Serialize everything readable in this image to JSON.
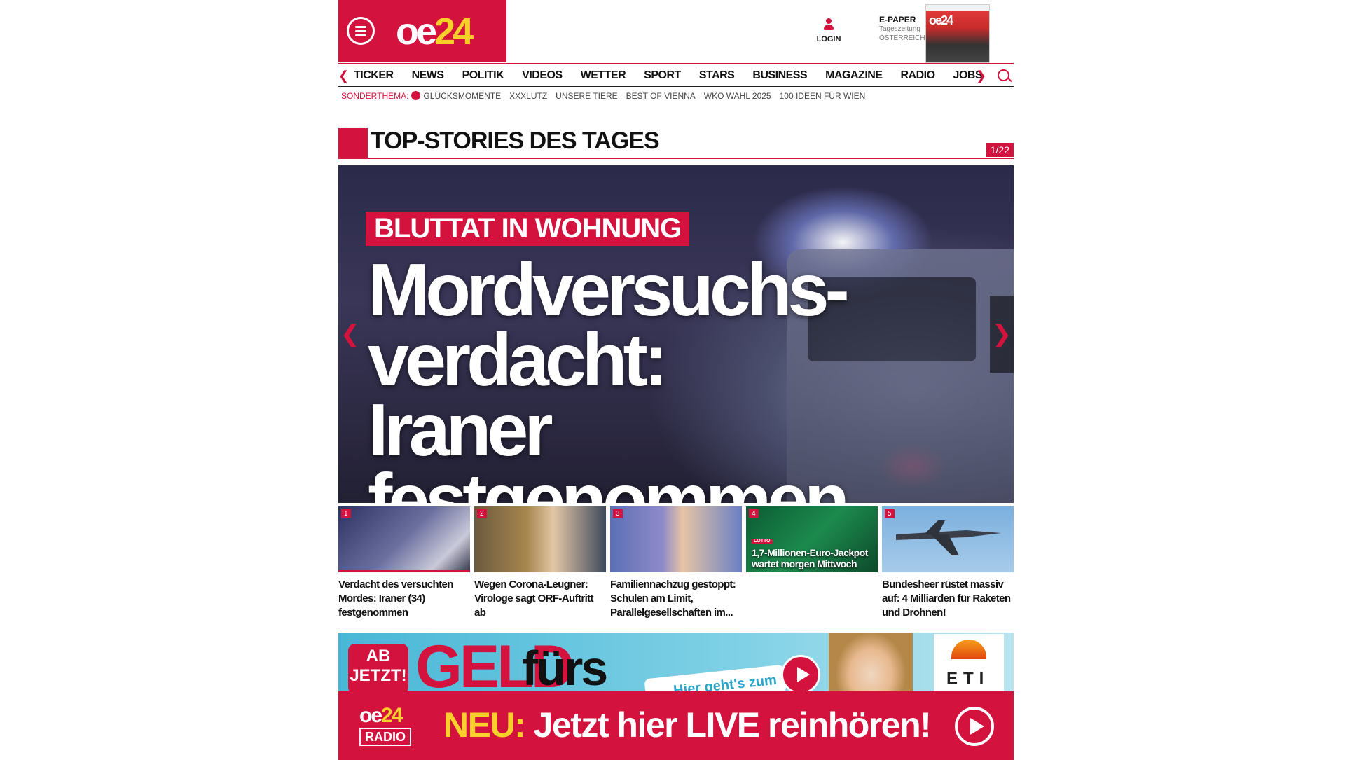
{
  "header": {
    "logo_main": "oe",
    "logo_accent": "24",
    "login_label": "LOGIN",
    "epaper_title": "E-PAPER",
    "epaper_sub1": "Tageszeitung",
    "epaper_sub2": "ÖSTERREICH",
    "cover_text": "oe24"
  },
  "nav": {
    "items": [
      "TICKER",
      "NEWS",
      "POLITIK",
      "VIDEOS",
      "WETTER",
      "SPORT",
      "STARS",
      "BUSINESS",
      "MAGAZINE",
      "RADIO",
      "JOBS"
    ],
    "prev_arrow": "❮",
    "next_arrow": "❯"
  },
  "subnav": {
    "label": "SONDERTHEMA:",
    "items": [
      "GLÜCKSMOMENTE",
      "XXXLUTZ",
      "UNSERE TIERE",
      "BEST OF VIENNA",
      "WKO WAHL 2025",
      "100 IDEEN FÜR WIEN"
    ]
  },
  "section": {
    "title": "TOP-STORIES DES TAGES",
    "counter": "1/22"
  },
  "hero": {
    "tag": "BLUTTAT IN WOHNUNG",
    "headline": "Mordversuchs-verdacht: Iraner festgenommen",
    "prev": "❮",
    "next": "❯"
  },
  "teasers": [
    {
      "num": "1",
      "caption": "Verdacht des versuchten Mordes: Iraner (34) festgenommen",
      "overlay": "",
      "overlay_tag": ""
    },
    {
      "num": "2",
      "caption": "Wegen Corona-Leugner: Virologe sagt ORF-Auftritt ab",
      "overlay": "",
      "overlay_tag": ""
    },
    {
      "num": "3",
      "caption": "Familiennachzug gestoppt: Schulen am Limit, Parallelgesellschaften im...",
      "overlay": "",
      "overlay_tag": ""
    },
    {
      "num": "4",
      "caption": "",
      "overlay": "1,7-Millionen-Euro-Jackpot wartet morgen Mittwoch",
      "overlay_tag": "LOTTO"
    },
    {
      "num": "5",
      "caption": "Bundesheer rüstet massiv auf: 4 Milliarden für Raketen und Drohnen!",
      "overlay": "",
      "overlay_tag": ""
    }
  ],
  "ad": {
    "ab_jetzt_1": "AB",
    "ab_jetzt_2": "JETZT!",
    "geld": "GELD",
    "furs": "fürs",
    "hier": "Hier geht's zum",
    "brand": "ETI"
  },
  "radio": {
    "logo_main": "oe",
    "logo_accent": "24",
    "logo_radio": "RADIO",
    "neu": "NEU:",
    "text": " Jetzt hier LIVE reinhören!"
  },
  "colors": {
    "brand": "#d4123e",
    "accent": "#f7d02b"
  }
}
